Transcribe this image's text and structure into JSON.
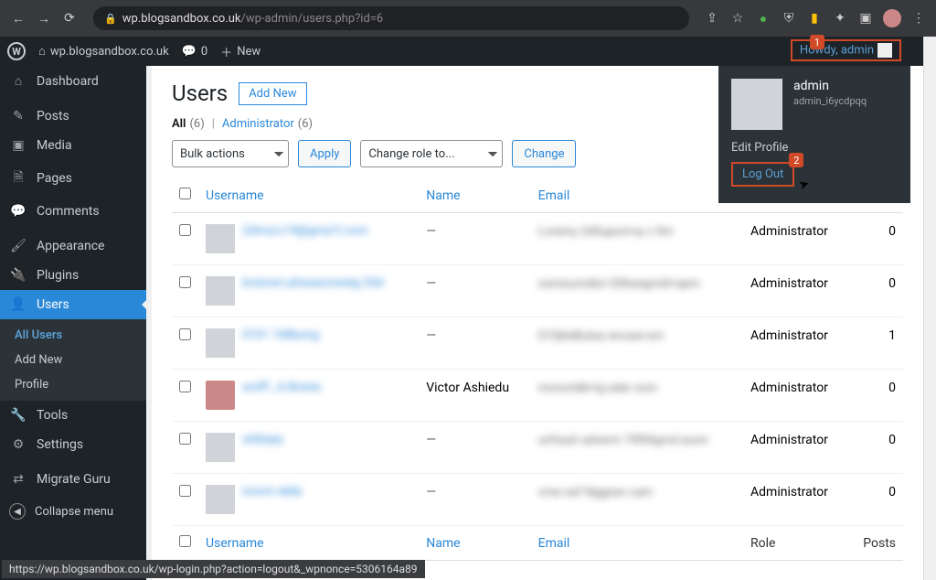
{
  "browser": {
    "url_domain": "wp.blogsandbox.co.uk",
    "url_path": "/wp-admin/users.php?id=6"
  },
  "wpbar": {
    "site": "wp.blogsandbox.co.uk",
    "comments": "0",
    "new": "New",
    "howdy": "Howdy, admin",
    "badge1": "1"
  },
  "sidebar": {
    "items": [
      {
        "label": "Dashboard",
        "icon": "⌂"
      },
      {
        "label": "Posts",
        "icon": "✎"
      },
      {
        "label": "Media",
        "icon": "▣"
      },
      {
        "label": "Pages",
        "icon": "🗎"
      },
      {
        "label": "Comments",
        "icon": "💬"
      },
      {
        "label": "Appearance",
        "icon": "🖌"
      },
      {
        "label": "Plugins",
        "icon": "🔌"
      },
      {
        "label": "Users",
        "icon": "👤"
      },
      {
        "label": "Tools",
        "icon": "🔧"
      },
      {
        "label": "Settings",
        "icon": "⚙"
      },
      {
        "label": "Migrate Guru",
        "icon": "⇄"
      }
    ],
    "sub": [
      "All Users",
      "Add New",
      "Profile"
    ],
    "collapse": "Collapse menu"
  },
  "page": {
    "title": "Users",
    "add_new": "Add New",
    "filter_all": "All",
    "filter_all_cnt": "(6)",
    "filter_admin": "Administrator",
    "filter_admin_cnt": "(6)",
    "bulk_label": "Bulk actions",
    "apply": "Apply",
    "role_label": "Change role to...",
    "change": "Change",
    "cols": {
      "username": "Username",
      "name": "Name",
      "email": "Email",
      "role": "Role",
      "posts": "Posts"
    }
  },
  "rows": [
    {
      "username": "2dmuLv14@gma1l.com",
      "name": "—",
      "email": "Loremy 2d0upum+p c 0m",
      "role": "Administrator",
      "posts": "0",
      "avatar": "blank"
    },
    {
      "username": "brulown phwasonwieg 53d",
      "name": "—",
      "email": "ownisumdlol 33llwegmdl+qem",
      "role": "Administrator",
      "posts": "0",
      "avatar": "blank"
    },
    {
      "username": "0101 7diBumg",
      "name": "—",
      "email": "010jlteBulwy encare-sm",
      "role": "Administrator",
      "posts": "1",
      "avatar": "blank"
    },
    {
      "username": "wolff _A.Bowie",
      "name": "Victor Ashiedu",
      "email": "monorldb+ig eder xom",
      "role": "Administrator",
      "posts": "0",
      "avatar": "real"
    },
    {
      "username": "w6bqey",
      "name": "—",
      "email": "unfrauh adverm 70fitltgmd eumr",
      "role": "Administrator",
      "posts": "0",
      "avatar": "blank"
    },
    {
      "username": "lvonm dally",
      "name": "—",
      "email": "vrne oaf fdggnev cam",
      "role": "Administrator",
      "posts": "0",
      "avatar": "blank"
    }
  ],
  "profile": {
    "name": "admin",
    "handle": "admin_i6ycdpqq",
    "edit": "Edit Profile",
    "logout": "Log Out",
    "badge2": "2"
  },
  "status_url": "https://wp.blogsandbox.co.uk/wp-login.php?action=logout&_wpnonce=5306164a89"
}
